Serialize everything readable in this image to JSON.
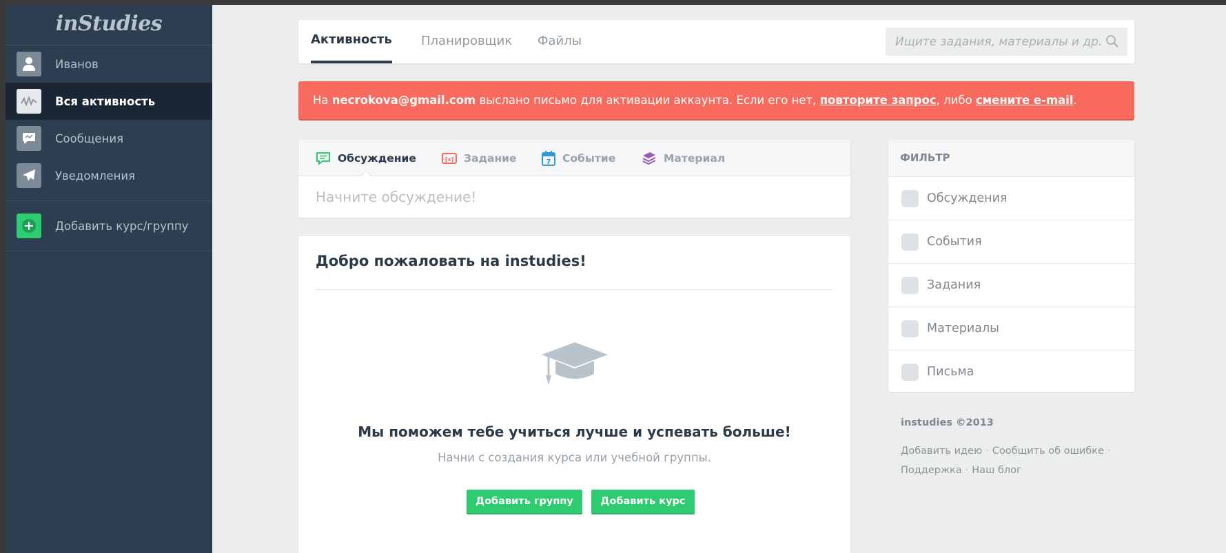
{
  "app": {
    "logo": "inStudies"
  },
  "sidebar": {
    "items": [
      {
        "label": "Иванов",
        "icon": "user-icon",
        "active": false
      },
      {
        "label": "Вся активность",
        "icon": "activity-icon",
        "active": true
      },
      {
        "label": "Сообщения",
        "icon": "messages-icon",
        "active": false
      },
      {
        "label": "Уведомления",
        "icon": "notifications-icon",
        "active": false
      }
    ],
    "add_label": "Добавить курс/группу",
    "add_icon": "plus-circle-icon"
  },
  "topbar": {
    "tabs": [
      {
        "label": "Активность",
        "active": true
      },
      {
        "label": "Планировщик",
        "active": false
      },
      {
        "label": "Файлы",
        "active": false
      }
    ],
    "search_placeholder": "Ищите задания, материалы и др."
  },
  "alert": {
    "prefix": "На ",
    "email": "necrokova@gmail.com",
    "middle": " выслано письмо для активации аккаунта. Если его нет, ",
    "link1": "повторите запрос",
    "between": ", либо ",
    "link2": "смените e-mail",
    "suffix": "."
  },
  "composer": {
    "tabs": [
      {
        "label": "Обсуждение",
        "icon": "chat-icon",
        "color": "#2ecc71",
        "active": true
      },
      {
        "label": "Задание",
        "icon": "task-icon",
        "color": "#f86a5d",
        "active": false
      },
      {
        "label": "Событие",
        "icon": "calendar-icon",
        "color": "#3498db",
        "active": false
      },
      {
        "label": "Материал",
        "icon": "material-icon",
        "color": "#9b59b6",
        "active": false
      }
    ],
    "calendar_day": "7",
    "placeholder": "Начните обсуждение!"
  },
  "welcome": {
    "title": "Добро пожаловать на instudies!",
    "headline": "Мы поможем тебе учиться лучше и успевать больше!",
    "subtext": "Начни с создания курса или учебной группы.",
    "btn_group": "Добавить группу",
    "btn_course": "Добавить курс"
  },
  "filter": {
    "title": "ФИЛЬТР",
    "options": [
      "Обсуждения",
      "События",
      "Задания",
      "Материалы",
      "Письма"
    ]
  },
  "footer": {
    "brand": "instudies ©2013",
    "links": [
      "Добавить идею",
      "Сообщить об ошибке",
      "Поддержка",
      "Наш блог"
    ],
    "separator": "·"
  },
  "colors": {
    "sidebar_bg": "#2d3e50",
    "accent_green": "#2ecc71",
    "alert_red": "#f86a5d",
    "page_bg": "#eceded"
  }
}
